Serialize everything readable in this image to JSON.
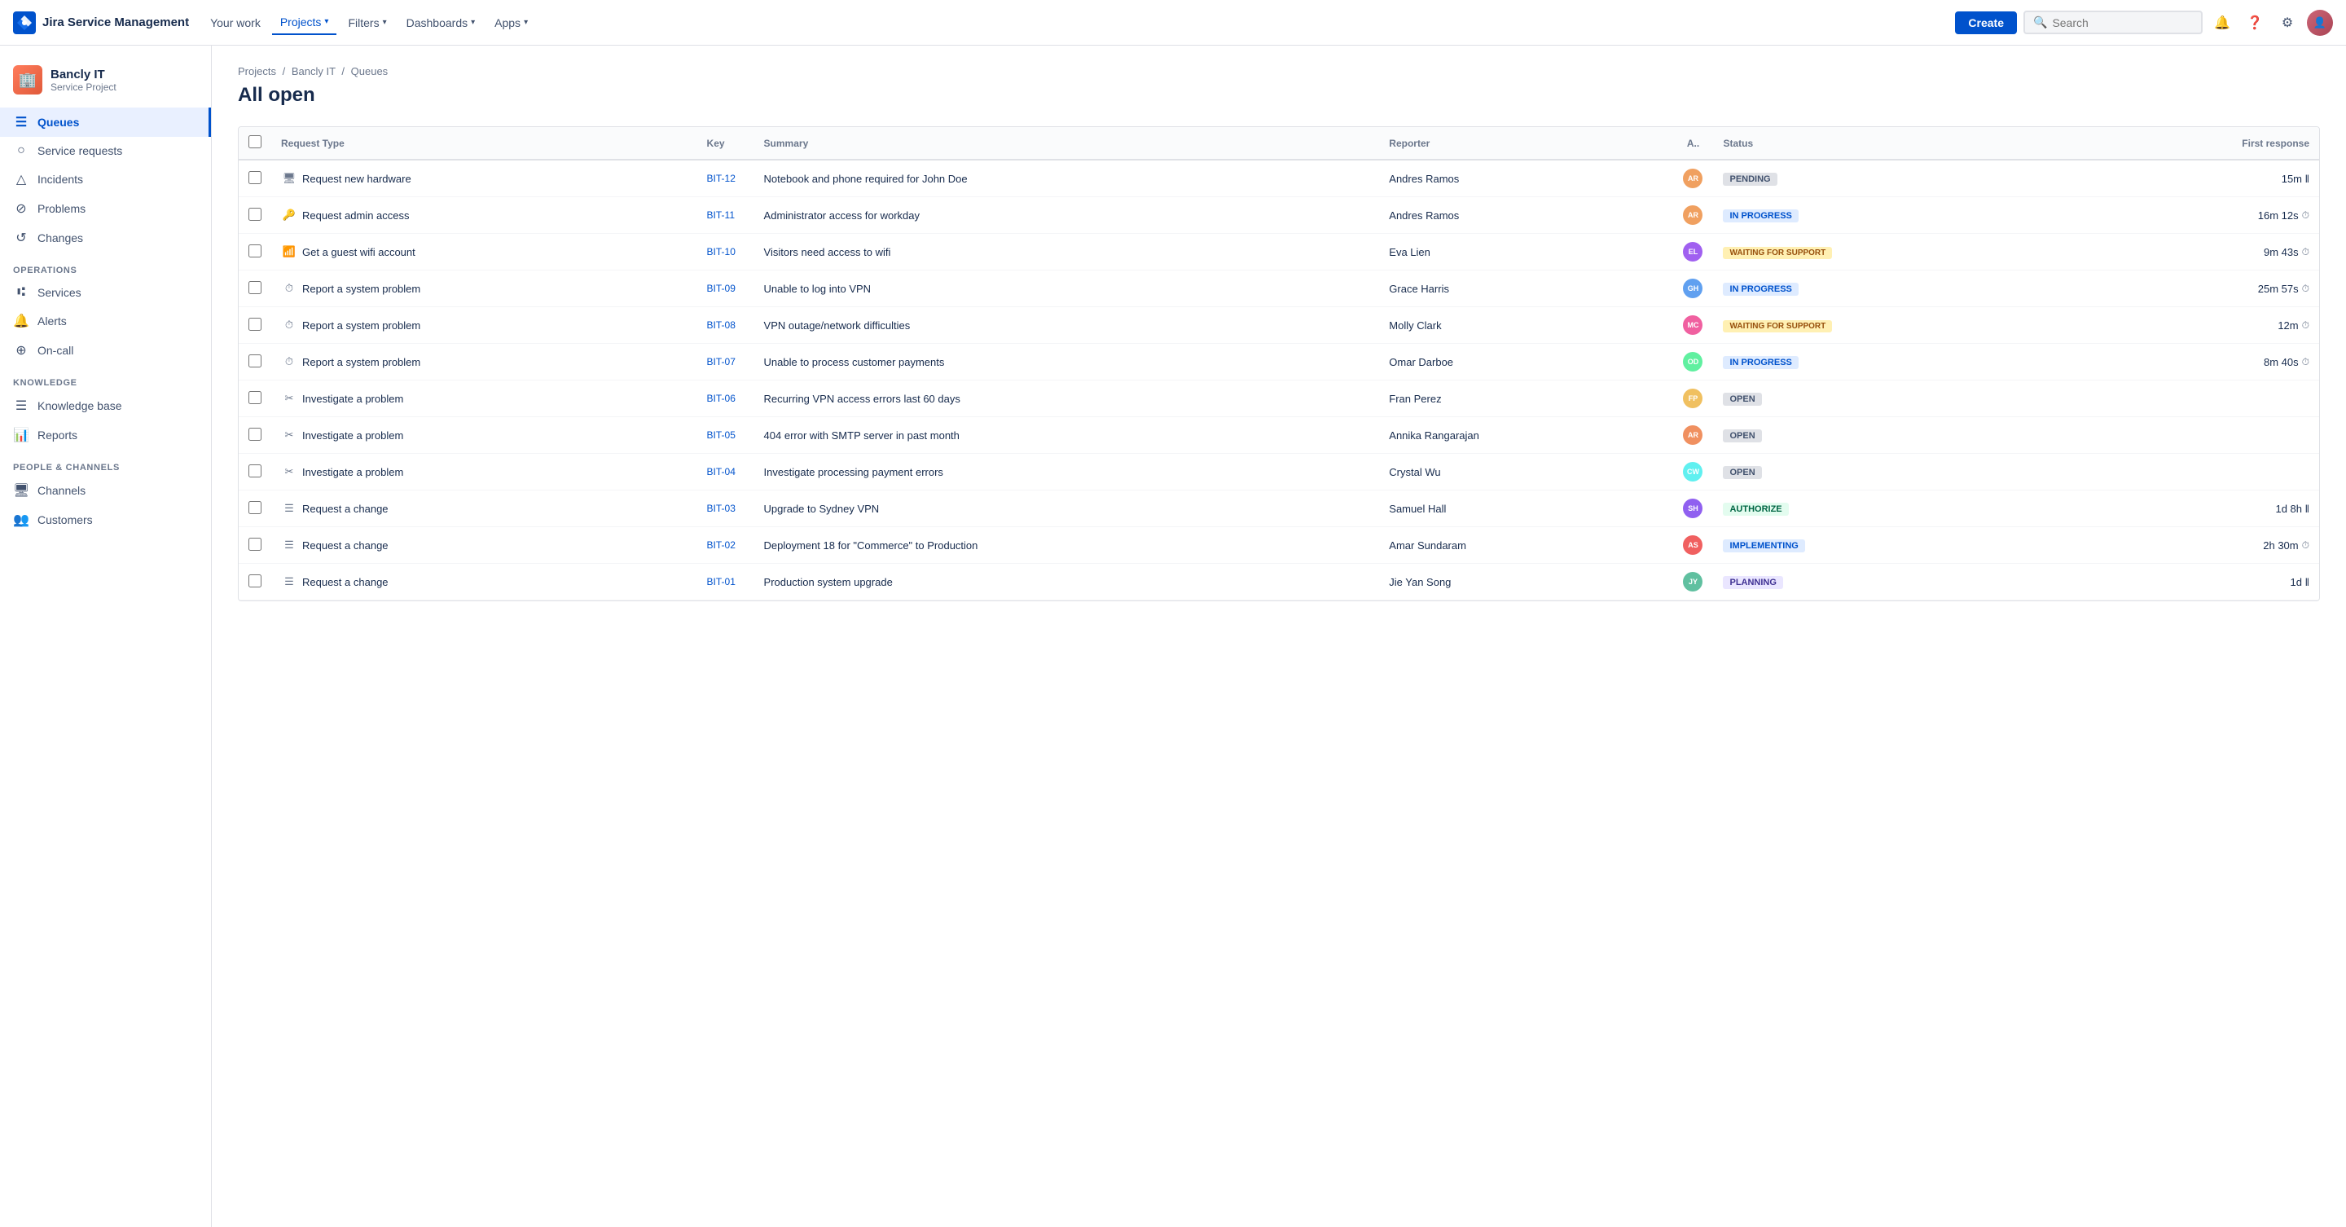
{
  "topnav": {
    "logo_text": "Jira Service Management",
    "links": [
      {
        "label": "Your work",
        "active": false
      },
      {
        "label": "Projects",
        "active": true,
        "has_chevron": true
      },
      {
        "label": "Filters",
        "active": false,
        "has_chevron": true
      },
      {
        "label": "Dashboards",
        "active": false,
        "has_chevron": true
      },
      {
        "label": "Apps",
        "active": false,
        "has_chevron": true
      }
    ],
    "create_label": "Create",
    "search_placeholder": "Search"
  },
  "sidebar": {
    "project_name": "Bancly IT",
    "project_type": "Service Project",
    "nav_items": [
      {
        "label": "Queues",
        "icon": "☰",
        "active": true
      },
      {
        "label": "Service requests",
        "icon": "○",
        "active": false
      },
      {
        "label": "Incidents",
        "icon": "△",
        "active": false
      },
      {
        "label": "Problems",
        "icon": "⊘",
        "active": false
      },
      {
        "label": "Changes",
        "icon": "↺",
        "active": false
      }
    ],
    "operations_label": "OPERATIONS",
    "operations_items": [
      {
        "label": "Services",
        "icon": "⑆",
        "active": false
      },
      {
        "label": "Alerts",
        "icon": "🔔",
        "active": false
      },
      {
        "label": "On-call",
        "icon": "⊕",
        "active": false
      }
    ],
    "knowledge_label": "KNOWLEDGE",
    "knowledge_items": [
      {
        "label": "Knowledge base",
        "icon": "☰",
        "active": false
      },
      {
        "label": "Reports",
        "icon": "📊",
        "active": false
      }
    ],
    "people_label": "PEOPLE & CHANNELS",
    "people_items": [
      {
        "label": "Channels",
        "icon": "🖥",
        "active": false
      },
      {
        "label": "Customers",
        "icon": "👥",
        "active": false
      }
    ]
  },
  "breadcrumb": {
    "items": [
      "Projects",
      "Bancly IT",
      "Queues"
    ]
  },
  "page_title": "All open",
  "table": {
    "columns": [
      "",
      "Request Type",
      "Key",
      "Summary",
      "Reporter",
      "A..",
      "Status",
      "First response"
    ],
    "rows": [
      {
        "id": "bit12",
        "req_icon": "🖥",
        "req_type": "Request new hardware",
        "key": "BIT-12",
        "summary": "Notebook and phone required for John Doe",
        "reporter": "Andres Ramos",
        "status": "PENDING",
        "status_class": "badge-pending",
        "first_response": "15m ‖",
        "fr_has_icon": false
      },
      {
        "id": "bit11",
        "req_icon": "🔑",
        "req_type": "Request admin access",
        "key": "BIT-11",
        "summary": "Administrator access for workday",
        "reporter": "Andres Ramos",
        "status": "IN PROGRESS",
        "status_class": "badge-inprogress",
        "first_response": "16m 12s",
        "fr_has_icon": true
      },
      {
        "id": "bit10",
        "req_icon": "📶",
        "req_type": "Get a guest wifi account",
        "key": "BIT-10",
        "summary": "Visitors need access to wifi",
        "reporter": "Eva Lien",
        "status": "WAITING FOR SUPPORT",
        "status_class": "badge-waiting",
        "first_response": "9m 43s",
        "fr_has_icon": true
      },
      {
        "id": "bit09",
        "req_icon": "⏱",
        "req_type": "Report a system problem",
        "key": "BIT-09",
        "summary": "Unable to log into VPN",
        "reporter": "Grace Harris",
        "status": "IN PROGRESS",
        "status_class": "badge-inprogress",
        "first_response": "25m 57s",
        "fr_has_icon": true
      },
      {
        "id": "bit08",
        "req_icon": "⏱",
        "req_type": "Report a system problem",
        "key": "BIT-08",
        "summary": "VPN outage/network difficulties",
        "reporter": "Molly Clark",
        "status": "WAITING FOR SUPPORT",
        "status_class": "badge-waiting",
        "first_response": "12m",
        "fr_has_icon": true
      },
      {
        "id": "bit07",
        "req_icon": "⏱",
        "req_type": "Report a system problem",
        "key": "BIT-07",
        "summary": "Unable to process customer payments",
        "reporter": "Omar Darboe",
        "status": "IN PROGRESS",
        "status_class": "badge-inprogress",
        "first_response": "8m 40s",
        "fr_has_icon": true
      },
      {
        "id": "bit06",
        "req_icon": "✂",
        "req_type": "Investigate a problem",
        "key": "BIT-06",
        "summary": "Recurring VPN access errors last 60 days",
        "reporter": "Fran Perez",
        "status": "OPEN",
        "status_class": "badge-open",
        "first_response": "",
        "fr_has_icon": false
      },
      {
        "id": "bit05",
        "req_icon": "✂",
        "req_type": "Investigate a problem",
        "key": "BIT-05",
        "summary": "404 error with SMTP server in past month",
        "reporter": "Annika Rangarajan",
        "status": "OPEN",
        "status_class": "badge-open",
        "first_response": "",
        "fr_has_icon": false
      },
      {
        "id": "bit04",
        "req_icon": "✂",
        "req_type": "Investigate a problem",
        "key": "BIT-04",
        "summary": "Investigate processing payment errors",
        "reporter": "Crystal Wu",
        "status": "OPEN",
        "status_class": "badge-open",
        "first_response": "",
        "fr_has_icon": false
      },
      {
        "id": "bit03",
        "req_icon": "☰",
        "req_type": "Request a change",
        "key": "BIT-03",
        "summary": "Upgrade to Sydney VPN",
        "reporter": "Samuel Hall",
        "status": "AUTHORIZE",
        "status_class": "badge-authorize",
        "first_response": "1d 8h ‖",
        "fr_has_icon": false
      },
      {
        "id": "bit02",
        "req_icon": "☰",
        "req_type": "Request a change",
        "key": "BIT-02",
        "summary": "Deployment 18 for \"Commerce\" to Production",
        "reporter": "Amar Sundaram",
        "status": "IMPLEMENTING",
        "status_class": "badge-implementing",
        "first_response": "2h 30m",
        "fr_has_icon": true
      },
      {
        "id": "bit01",
        "req_icon": "☰",
        "req_type": "Request a change",
        "key": "BIT-01",
        "summary": "Production system upgrade",
        "reporter": "Jie Yan Song",
        "status": "PLANNING",
        "status_class": "badge-planning",
        "first_response": "1d ‖",
        "fr_has_icon": false
      }
    ]
  }
}
